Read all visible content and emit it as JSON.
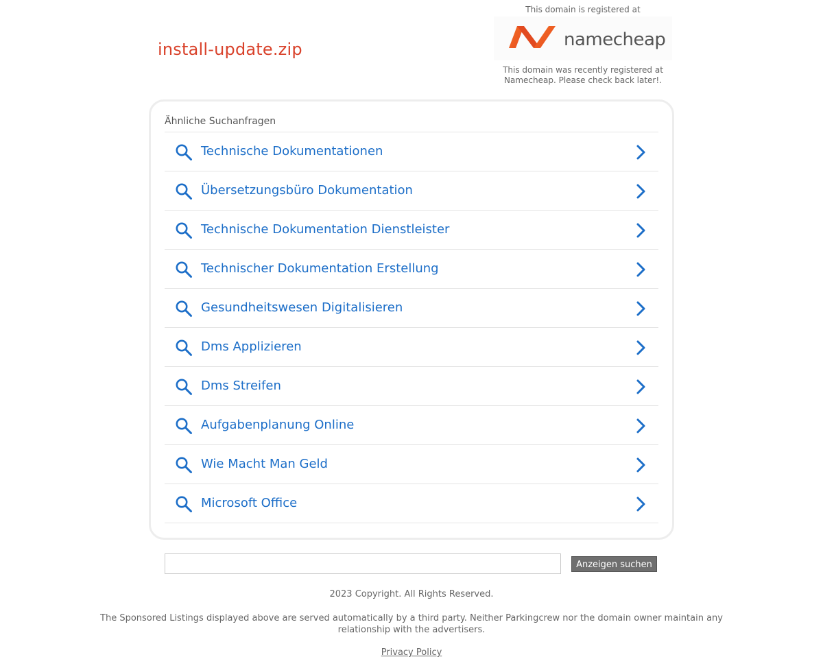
{
  "domain": {
    "name": "install-update.zip"
  },
  "registrar": {
    "top_text": "This domain is registered at",
    "logo_name": "namecheap",
    "bottom_text": "This domain was recently registered at Namecheap. Please check back later!."
  },
  "related": {
    "heading": "Ähnliche Suchanfragen",
    "items": [
      {
        "label": "Technische Dokumentationen"
      },
      {
        "label": "Übersetzungsbüro Dokumentation"
      },
      {
        "label": "Technische Dokumentation Dienstleister"
      },
      {
        "label": "Technischer Dokumentation Erstellung"
      },
      {
        "label": "Gesundheitswesen Digitalisieren"
      },
      {
        "label": "Dms Applizieren"
      },
      {
        "label": "Dms Streifen"
      },
      {
        "label": "Aufgabenplanung Online"
      },
      {
        "label": "Wie Macht Man Geld"
      },
      {
        "label": "Microsoft Office"
      }
    ]
  },
  "search": {
    "value": "",
    "button_label": "Anzeigen suchen"
  },
  "footer": {
    "copyright": "2023 Copyright. All Rights Reserved.",
    "disclaimer": "The Sponsored Listings displayed above are served automatically by a third party. Neither Parkingcrew nor the domain owner maintain any relationship with the advertisers.",
    "privacy_label": "Privacy Policy"
  },
  "colors": {
    "domain_title": "#d9422b",
    "link": "#1c6ec8",
    "logo_orange": "#ef5a24"
  }
}
